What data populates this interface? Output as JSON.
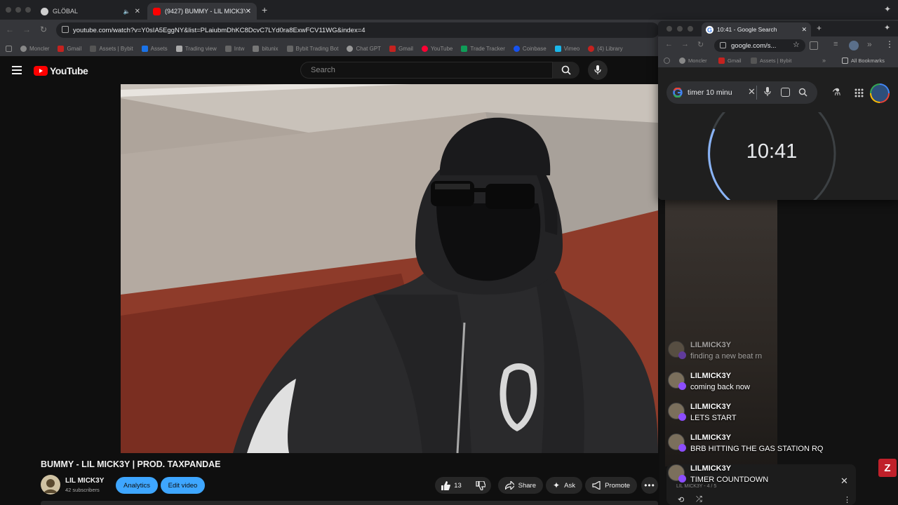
{
  "main_browser": {
    "tabs": [
      {
        "label": "GLÖBAL",
        "active": false
      },
      {
        "label": "(9427) BUMMY - LIL MICK3Y",
        "active": true
      }
    ],
    "url": "youtube.com/watch?v=Y0sIA5EggNY&list=PLaiubmDhKC8DcvC7LYd0ra8ExwFCV11WG&index=4",
    "bookmarks": [
      "Moncler",
      "Gmail",
      "Assets | Bybit",
      "Assets",
      "Trading view",
      "Intw",
      "bitunix",
      "Bybit Trading Bot",
      "Chat GPT",
      "Gmail",
      "YouTube",
      "Trade Tracker",
      "Coinbase",
      "Vimeo",
      "(4) Library"
    ]
  },
  "youtube": {
    "logo_text": "YouTube",
    "search_placeholder": "Search",
    "video_title": "BUMMY - LIL MICK3Y | PROD. TAXPANDAE",
    "channel_name": "LIL MICK3Y",
    "subscribers": "42 subscribers",
    "analytics_label": "Analytics",
    "edit_video_label": "Edit video",
    "like_count": "13",
    "share_label": "Share",
    "ask_label": "Ask",
    "promote_label": "Promote"
  },
  "popup_browser": {
    "tab_title": "10:41 - Google Search",
    "url": "google.com/s...",
    "bookmarks": [
      "Moncler",
      "Gmail",
      "Assets | Bybit",
      "All Bookmarks"
    ],
    "search_query": "timer 10 minu",
    "timer_value": "10:41"
  },
  "chat": {
    "messages": [
      {
        "name": "LILMICK3Y",
        "text": "finding a new beat rn"
      },
      {
        "name": "LILMICK3Y",
        "text": "coming back now"
      },
      {
        "name": "LILMICK3Y",
        "text": "LETS START"
      },
      {
        "name": "LILMICK3Y",
        "text": "BRB HITTING THE GAS STATION RQ"
      },
      {
        "name": "LILMICK3Y",
        "text": "TIMER COUNTDOWN"
      }
    ]
  },
  "mini_player": {
    "channel": "LIL MICK3Y",
    "position": "4 / 5"
  },
  "colors": {
    "yt_red": "#ff0000",
    "accent_blue": "#3ea6ff",
    "chat_badge": "#8c4dff"
  }
}
